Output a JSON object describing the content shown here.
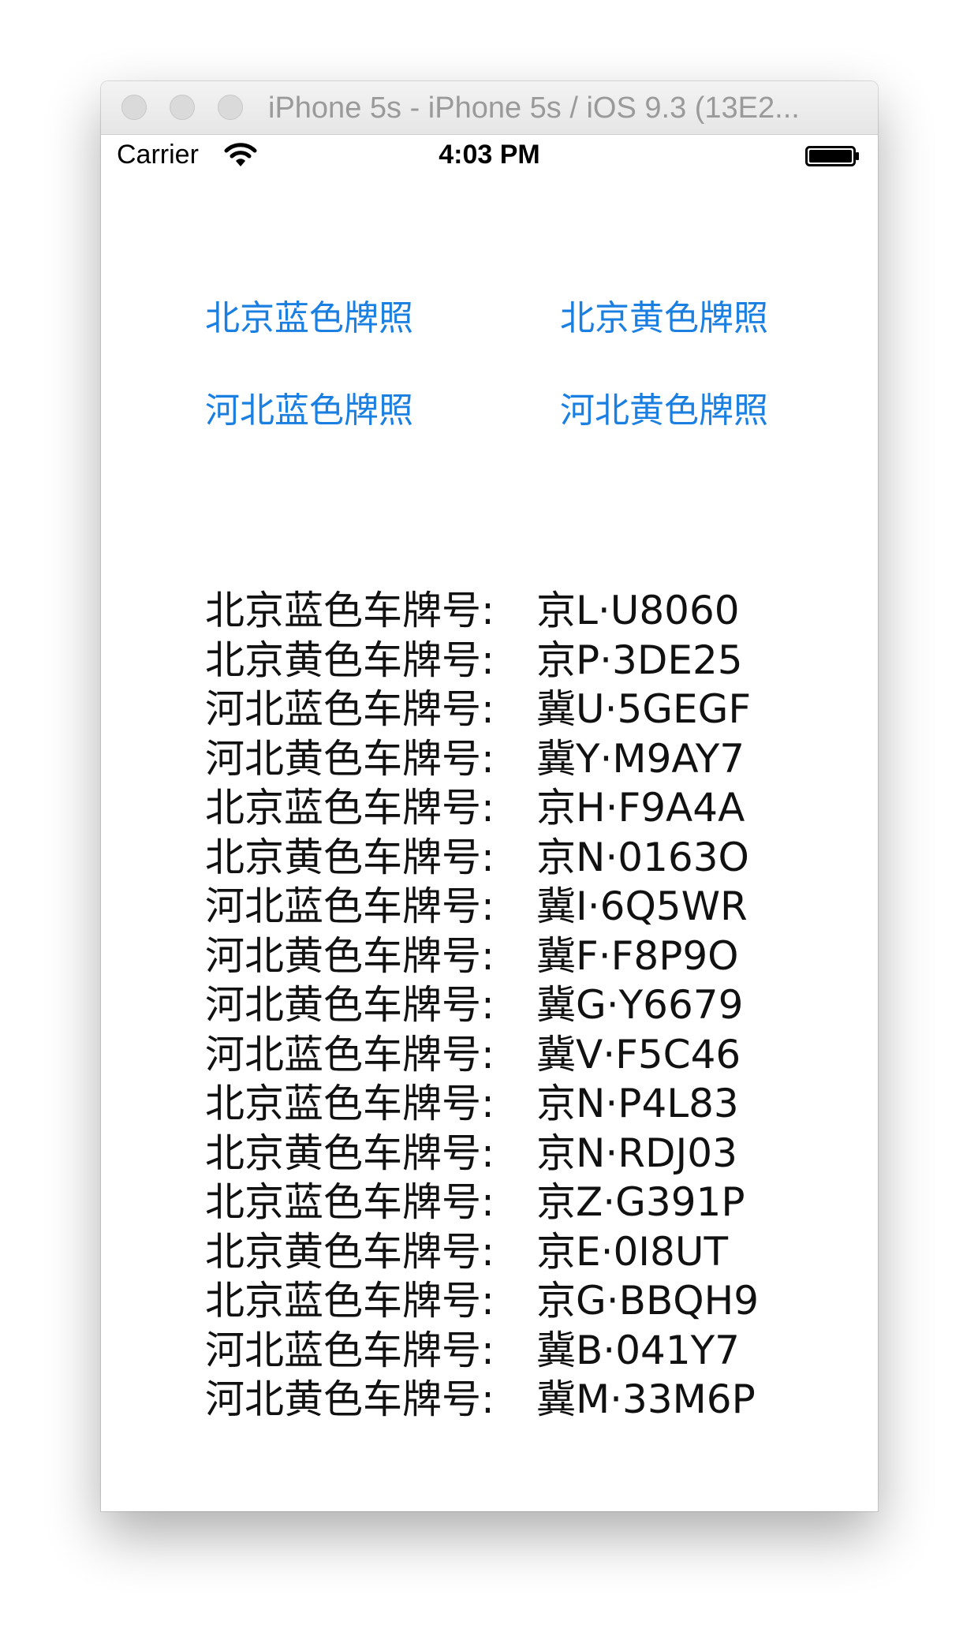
{
  "window": {
    "title": "iPhone 5s - iPhone 5s / iOS 9.3 (13E2..."
  },
  "status_bar": {
    "carrier": "Carrier",
    "time": "4:03 PM",
    "wifi_icon": "wifi-icon",
    "battery_icon": "battery-icon"
  },
  "buttons": {
    "beijing_blue": "北京蓝色牌照",
    "beijing_yellow": "北京黄色牌照",
    "hebei_blue": "河北蓝色牌照",
    "hebei_yellow": "河北黄色牌照"
  },
  "colors": {
    "button_tint": "#1a7fe0",
    "text": "#111111"
  },
  "plates": [
    {
      "label": "北京蓝色车牌号:",
      "value": "京L·U8060"
    },
    {
      "label": "北京黄色车牌号:",
      "value": "京P·3DE25"
    },
    {
      "label": "河北蓝色车牌号:",
      "value": "冀U·5GEGF"
    },
    {
      "label": "河北黄色车牌号:",
      "value": "冀Y·M9AY7"
    },
    {
      "label": "北京蓝色车牌号:",
      "value": "京H·F9A4A"
    },
    {
      "label": "北京黄色车牌号:",
      "value": "京N·0163O"
    },
    {
      "label": "河北蓝色车牌号:",
      "value": "冀I·6Q5WR"
    },
    {
      "label": "河北黄色车牌号:",
      "value": "冀F·F8P9O"
    },
    {
      "label": "河北黄色车牌号:",
      "value": "冀G·Y6679"
    },
    {
      "label": "河北蓝色车牌号:",
      "value": "冀V·F5C46"
    },
    {
      "label": "北京蓝色车牌号:",
      "value": "京N·P4L83"
    },
    {
      "label": "北京黄色车牌号:",
      "value": "京N·RDJ03"
    },
    {
      "label": "北京蓝色车牌号:",
      "value": "京Z·G391P"
    },
    {
      "label": "北京黄色车牌号:",
      "value": "京E·0I8UT"
    },
    {
      "label": "北京蓝色车牌号:",
      "value": "京G·BBQH9"
    },
    {
      "label": "河北蓝色车牌号:",
      "value": "冀B·041Y7"
    },
    {
      "label": "河北黄色车牌号:",
      "value": "冀M·33M6P"
    }
  ]
}
